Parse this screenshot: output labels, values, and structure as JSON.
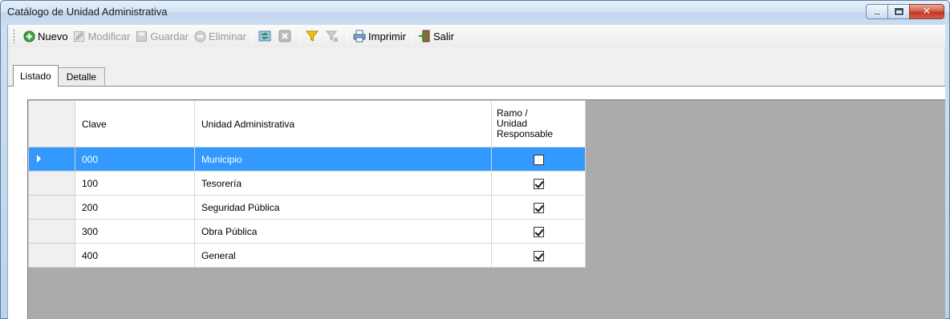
{
  "window": {
    "title": "Catálogo de Unidad Administrativa"
  },
  "toolbar": {
    "items": [
      {
        "label": "Nuevo",
        "icon": "add-circle-icon",
        "enabled": true
      },
      {
        "label": "Modificar",
        "icon": "edit-icon",
        "enabled": false
      },
      {
        "label": "Guardar",
        "icon": "save-icon",
        "enabled": false
      },
      {
        "label": "Eliminar",
        "icon": "delete-circle-icon",
        "enabled": false
      },
      {
        "label": "",
        "icon": "refresh-icon",
        "enabled": true
      },
      {
        "label": "",
        "icon": "cancel-icon",
        "enabled": false
      },
      {
        "label": "",
        "icon": "filter-icon",
        "enabled": true
      },
      {
        "label": "",
        "icon": "clear-filter-icon",
        "enabled": false
      },
      {
        "label": "Imprimir",
        "icon": "printer-icon",
        "enabled": true
      },
      {
        "label": "Salir",
        "icon": "exit-door-icon",
        "enabled": true
      }
    ]
  },
  "tabs": [
    {
      "label": "Listado",
      "active": true
    },
    {
      "label": "Detalle",
      "active": false
    }
  ],
  "grid": {
    "columns": [
      "Clave",
      "Unidad Administrativa",
      "Ramo / Unidad Responsable"
    ],
    "header_lines": [
      "Ramo /",
      "Unidad",
      "Responsable"
    ],
    "rows": [
      {
        "clave": "000",
        "unidad": "Municipio",
        "ramo": false,
        "selected": true
      },
      {
        "clave": "100",
        "unidad": "Tesorería",
        "ramo": true,
        "selected": false
      },
      {
        "clave": "200",
        "unidad": "Seguridad Pública",
        "ramo": true,
        "selected": false
      },
      {
        "clave": "300",
        "unidad": "Obra Pública",
        "ramo": true,
        "selected": false
      },
      {
        "clave": "400",
        "unidad": "General",
        "ramo": true,
        "selected": false
      }
    ]
  },
  "colors": {
    "selection": "#3399ff",
    "grid_background": "#ababab"
  }
}
